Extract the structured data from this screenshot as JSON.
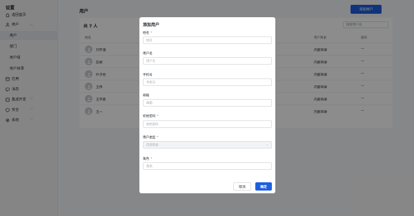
{
  "sidebar": {
    "title": "设置",
    "items": [
      {
        "label": "返回首页",
        "icon": "home-icon"
      },
      {
        "label": "用户",
        "icon": "user-icon"
      },
      {
        "label": "用户"
      },
      {
        "label": "部门"
      },
      {
        "label": "用户组"
      },
      {
        "label": "用户目录"
      },
      {
        "label": "应用",
        "icon": "app-icon"
      },
      {
        "label": "消息",
        "icon": "message-icon"
      },
      {
        "label": "集成开发",
        "icon": "code-icon"
      },
      {
        "label": "安全",
        "icon": "shield-icon"
      },
      {
        "label": "系统",
        "icon": "gear-icon"
      }
    ]
  },
  "main": {
    "title": "用户",
    "add_button": "添加用户",
    "count": "共 7 人",
    "search_placeholder": "搜索用户名",
    "columns": [
      "姓名",
      "用户目录",
      "操作"
    ],
    "rows": [
      {
        "name": "刘宇涵",
        "dir": "内部目录",
        "op": "—"
      },
      {
        "name": "彭斌",
        "dir": "内部目录",
        "op": "—"
      },
      {
        "name": "叶子怡",
        "dir": "内部目录",
        "op": "—"
      },
      {
        "name": "王伟",
        "dir": "内部目录",
        "op": "—"
      },
      {
        "name": "王宇豪",
        "dir": "内部目录",
        "op": "—"
      },
      {
        "name": "王一",
        "dir": "内部目录",
        "op": "—"
      }
    ]
  },
  "modal": {
    "title": "添加用户",
    "fields": [
      {
        "label": "姓名",
        "required": "*",
        "placeholder": "姓名"
      },
      {
        "label": "用户名",
        "required": "",
        "placeholder": "用户名"
      },
      {
        "label": "手机号",
        "required": "",
        "placeholder": "手机号"
      },
      {
        "label": "邮箱",
        "required": "",
        "placeholder": "邮箱"
      },
      {
        "label": "初始密码",
        "required": "*",
        "placeholder": "初始密码"
      },
      {
        "label": "用户类型",
        "required": "*",
        "placeholder": "内部目录"
      },
      {
        "label": "角色",
        "required": "*",
        "placeholder": "角色"
      }
    ],
    "cancel": "取消",
    "confirm": "确定"
  },
  "colors": {
    "accent": "#1e5fe0",
    "required": "#f54a45"
  }
}
